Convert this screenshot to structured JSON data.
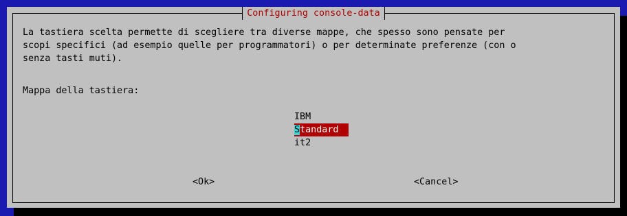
{
  "dialog": {
    "title": "Configuring console-data",
    "message_lines": [
      "La tastiera scelta permette di scegliere tra diverse mappe, che spesso sono pensate per",
      "scopi specifici (ad esempio quelle per programmatori) o per determinate preferenze (con o",
      "senza tasti muti)."
    ],
    "prompt": "Mappa della tastiera:",
    "options": [
      {
        "label": "IBM",
        "selected": false
      },
      {
        "label": "Standard",
        "selected": true,
        "cursor_char": "S",
        "rest": "tandard"
      },
      {
        "label": "it2",
        "selected": false
      }
    ],
    "ok_label": "<Ok>",
    "cancel_label": "<Cancel>"
  },
  "colors": {
    "background": "#1a1ab0",
    "dialog": "#c0c0c0",
    "title_text": "#b00000",
    "selection": "#b00000",
    "cursor": "#3ad7d7"
  }
}
